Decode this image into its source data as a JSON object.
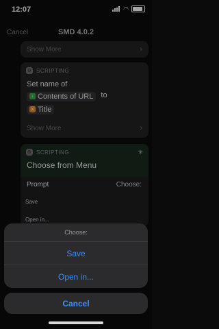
{
  "status": {
    "time": "12:07"
  },
  "nav": {
    "cancel": "Cancel",
    "title": "SMD 4.0.2"
  },
  "card1": {
    "show_more": "Show More"
  },
  "card2": {
    "category": "SCRIPTING",
    "line1": "Set name of",
    "token1": "Contents of URL",
    "to": "to",
    "token2": "Title",
    "show_more": "Show More"
  },
  "card3": {
    "category": "SCRIPTING",
    "title": "Choose from Menu",
    "prompt_label": "Prompt",
    "prompt_value": "Choose:",
    "item1": "Save",
    "item2": "Open in..."
  },
  "sheet": {
    "title": "Choose:",
    "options": [
      "Save",
      "Open in..."
    ],
    "cancel": "Cancel"
  },
  "colors": {
    "accent": "#3d8dff",
    "token_green": "#2fa84f",
    "token_orange": "#e8902a"
  }
}
